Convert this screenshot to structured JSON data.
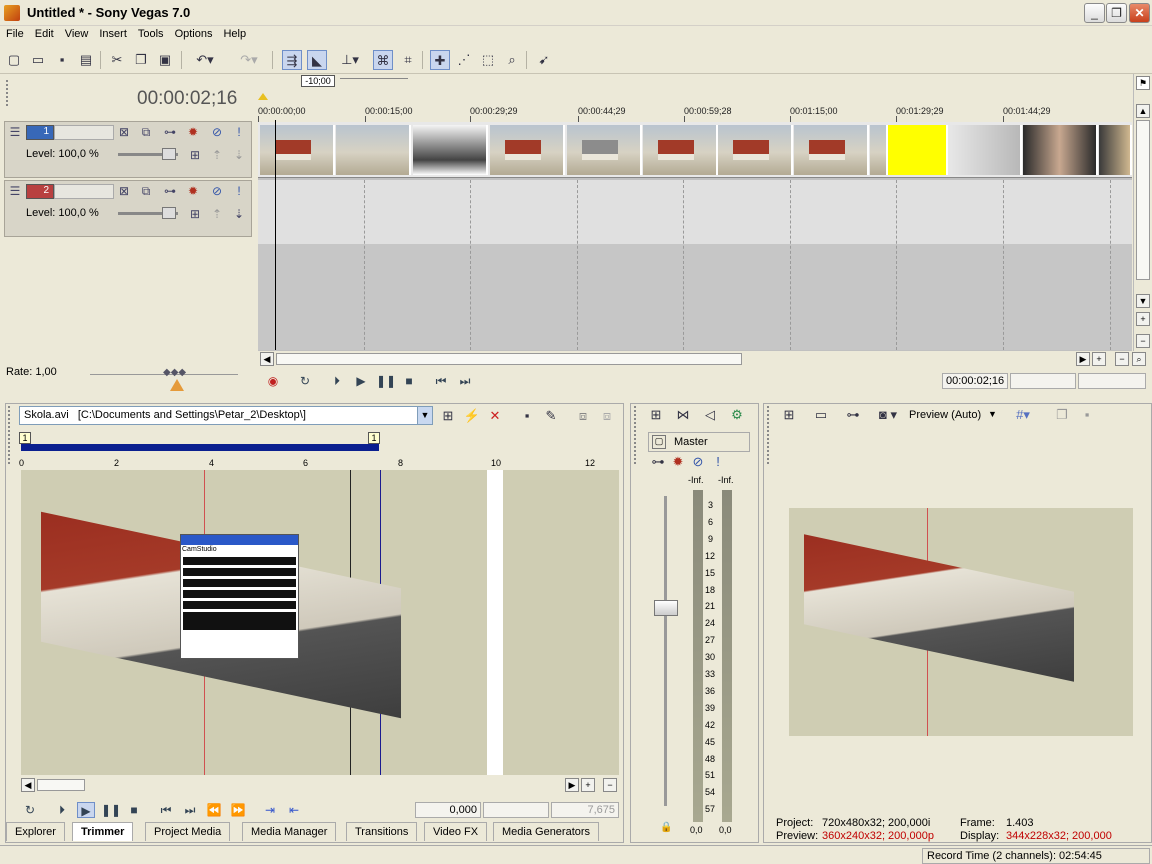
{
  "window": {
    "title": "Untitled * - Sony Vegas 7.0",
    "controls": [
      "_",
      "❐",
      "✕"
    ]
  },
  "menu": [
    "File",
    "Edit",
    "View",
    "Insert",
    "Tools",
    "Options",
    "Help"
  ],
  "timeline": {
    "current_time": "00:00:02;16",
    "marker_label": "-10;00",
    "ruler_labels": [
      "00:00:00;00",
      "00:00:15;00",
      "00:00:29;29",
      "00:00:44;29",
      "00:00:59;28",
      "00:01:15;00",
      "00:01:29;29",
      "00:01:44;29"
    ],
    "tracks": [
      {
        "number": "1",
        "level": "Level: 100,0 %",
        "color": "#3868b8"
      },
      {
        "number": "2",
        "level": "Level: 100,0 %",
        "color": "#b84040"
      }
    ],
    "rate": "Rate: 1,00",
    "transport_time": "00:00:02;16"
  },
  "trimmer": {
    "file": "Skola.avi",
    "path": "[C:\\Documents and Settings\\Petar_2\\Desktop\\]",
    "ruler_labels": [
      "0",
      "2",
      "4",
      "6",
      "8",
      "10",
      "12"
    ],
    "region_start": "1",
    "region_end": "1",
    "field_start": "0,000",
    "field_end": "7,675",
    "dialog_title": "CamStudio"
  },
  "mixer": {
    "bus": "Master",
    "peak_left": "-Inf.",
    "peak_right": "-Inf.",
    "scale": [
      "3",
      "6",
      "9",
      "12",
      "15",
      "18",
      "21",
      "24",
      "27",
      "30",
      "33",
      "36",
      "39",
      "42",
      "45",
      "48",
      "51",
      "54",
      "57"
    ],
    "value_left": "0,0",
    "value_right": "0,0"
  },
  "preview": {
    "mode_label": "Preview (Auto)",
    "project_label": "Project:",
    "project_value": "720x480x32; 200,000i",
    "frame_label": "Frame:",
    "frame_value": "1.403",
    "preview_label": "Preview:",
    "preview_value": "360x240x32; 200,000p",
    "display_label": "Display:",
    "display_value": "344x228x32; 200,000"
  },
  "tabs": [
    "Explorer",
    "Trimmer",
    "Project Media",
    "Media Manager",
    "Transitions",
    "Video FX",
    "Media Generators"
  ],
  "status": {
    "record_time": "Record Time (2 channels): 02:54:45"
  }
}
